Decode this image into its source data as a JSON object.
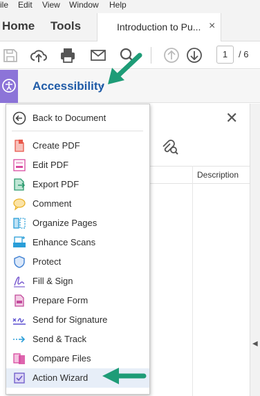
{
  "menubar": [
    "ile",
    "Edit",
    "View",
    "Window",
    "Help"
  ],
  "nav": {
    "home": "Home",
    "tools": "Tools",
    "document_tab": "Introduction to Pu...",
    "close_glyph": "×"
  },
  "toolbar": {
    "page_number": "1",
    "page_total": "/ 6"
  },
  "accessibility": {
    "title": "Accessibility",
    "caret": "▾"
  },
  "panel": {
    "close_glyph": "✕",
    "column_description": "Description"
  },
  "menu": {
    "back": "Back to Document",
    "items": [
      {
        "label": "Create PDF",
        "icon": "create-pdf-icon",
        "color": "#e8584a"
      },
      {
        "label": "Edit PDF",
        "icon": "edit-pdf-icon",
        "color": "#d94aa0"
      },
      {
        "label": "Export PDF",
        "icon": "export-pdf-icon",
        "color": "#2b9a6e"
      },
      {
        "label": "Comment",
        "icon": "comment-icon",
        "color": "#e9b227"
      },
      {
        "label": "Organize Pages",
        "icon": "organize-pages-icon",
        "color": "#2a9ed8"
      },
      {
        "label": "Enhance Scans",
        "icon": "enhance-scans-icon",
        "color": "#2a9ed8"
      },
      {
        "label": "Protect",
        "icon": "protect-icon",
        "color": "#3e7fd2"
      },
      {
        "label": "Fill & Sign",
        "icon": "fill-sign-icon",
        "color": "#7b5cd0"
      },
      {
        "label": "Prepare Form",
        "icon": "prepare-form-icon",
        "color": "#c24a9b"
      },
      {
        "label": "Send for Signature",
        "icon": "send-for-signature-icon",
        "color": "#5a4fd0"
      },
      {
        "label": "Send & Track",
        "icon": "send-track-icon",
        "color": "#2a9ed8"
      },
      {
        "label": "Compare Files",
        "icon": "compare-files-icon",
        "color": "#d84aa0"
      },
      {
        "label": "Action Wizard",
        "icon": "action-wizard-icon",
        "color": "#6a58c8"
      }
    ]
  },
  "colors": {
    "accent_blue": "#1f5ba7",
    "annotation_arrow": "#1e9c77",
    "accessibility_badge": "#8c74d8"
  }
}
